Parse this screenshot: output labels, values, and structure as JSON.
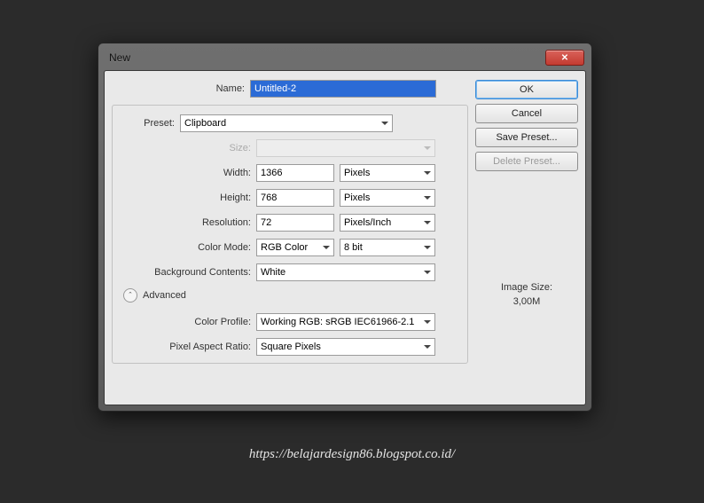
{
  "dialog": {
    "title": "New",
    "name_label": "Name:",
    "name_value": "Untitled-2",
    "preset_label": "Preset:",
    "preset_value": "Clipboard",
    "size_label": "Size:",
    "size_value": "",
    "width_label": "Width:",
    "width_value": "1366",
    "width_unit": "Pixels",
    "height_label": "Height:",
    "height_value": "768",
    "height_unit": "Pixels",
    "resolution_label": "Resolution:",
    "resolution_value": "72",
    "resolution_unit": "Pixels/Inch",
    "colormode_label": "Color Mode:",
    "colormode_value": "RGB Color",
    "colordepth_value": "8 bit",
    "bgcontents_label": "Background Contents:",
    "bgcontents_value": "White",
    "advanced_label": "Advanced",
    "colorprofile_label": "Color Profile:",
    "colorprofile_value": "Working RGB: sRGB IEC61966-2.1",
    "pixelaspect_label": "Pixel Aspect Ratio:",
    "pixelaspect_value": "Square Pixels"
  },
  "buttons": {
    "ok": "OK",
    "cancel": "Cancel",
    "save_preset": "Save Preset...",
    "delete_preset": "Delete Preset..."
  },
  "image_size": {
    "label": "Image Size:",
    "value": "3,00M"
  },
  "watermark": "https://belajardesign86.blogspot.co.id/"
}
